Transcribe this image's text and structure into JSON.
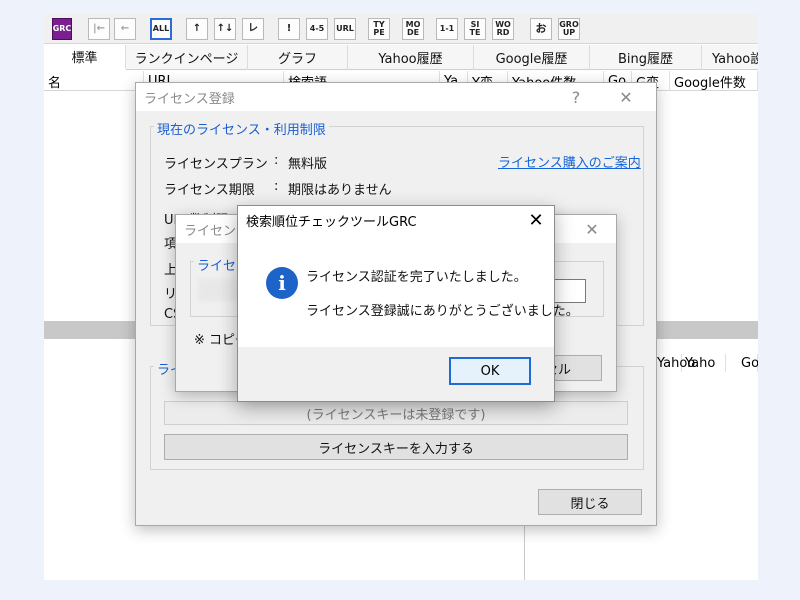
{
  "toolbar": {
    "buttons": [
      "GRC",
      "|←",
      "←",
      "ALL",
      "↑",
      "↑↓",
      "レ",
      "!",
      "4-5",
      "URL",
      "TY PE",
      "MO DE",
      "1-1",
      "SI TE",
      "WO RD",
      "お",
      "GRO UP"
    ]
  },
  "tabs": [
    "標準",
    "ランクインページ",
    "グラフ",
    "Yahoo履歴",
    "Google履歴",
    "Bing履歴",
    "Yahoo設"
  ],
  "columns": [
    "名",
    "URL",
    "検索語",
    "Ya",
    "Y変",
    "Yahoo件数",
    "Go",
    "G変",
    "Google件数"
  ],
  "lower_columns": [
    "Yahoo",
    "Yaho",
    "Go"
  ],
  "license_dialog": {
    "title": "ライセンス登録",
    "help": "?",
    "close": "✕",
    "group_current": "現在のライセンス・利用制限",
    "plan_label": "ライセンスプラン",
    "plan_value": "無料版",
    "period_label": "ライセンス期限",
    "period_value": "期限はありません",
    "separator": ":",
    "purchase_link": "ライセンス購入のご案内",
    "url_limit_label": "URL数制限",
    "item_label": "項",
    "upper_label": "上",
    "ri_label": "リ",
    "cs_label": "CS",
    "group_key_caption": "ライ",
    "key_status": "(ライセンスキーは未登録です)",
    "enter_key_button": "ライセンスキーを入力する",
    "close_button": "閉じる"
  },
  "key_dialog": {
    "title": "ライセンスキ",
    "close": "✕",
    "group_caption": "ライセン",
    "copy_note": "※ コピー",
    "cancel_button": "セル"
  },
  "message_box": {
    "title": "検索順位チェックツールGRC",
    "close": "✕",
    "icon": "i",
    "line1": "ライセンス認証を完了いたしました。",
    "line2": "ライセンス登録誠にありがとうございました。",
    "ok_button": "OK"
  }
}
